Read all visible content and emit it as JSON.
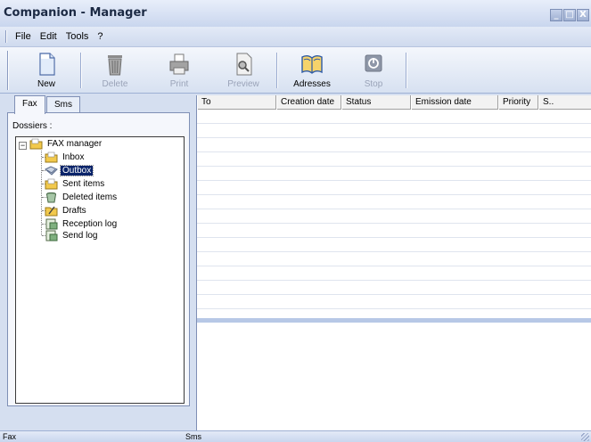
{
  "window": {
    "title": "Companion - Manager",
    "controls": {
      "minimize": "_",
      "maximize": "□",
      "close": "X"
    }
  },
  "menu": [
    {
      "label": "File"
    },
    {
      "label": "Edit"
    },
    {
      "label": "Tools"
    },
    {
      "label": "?"
    }
  ],
  "toolbar": {
    "buttons": [
      {
        "label": "New",
        "icon": "new-document-icon",
        "enabled": true
      },
      {
        "label": "Delete",
        "icon": "trash-icon",
        "enabled": false
      },
      {
        "label": "Print",
        "icon": "printer-icon",
        "enabled": false
      },
      {
        "label": "Preview",
        "icon": "preview-icon",
        "enabled": false
      },
      {
        "label": "Adresses",
        "icon": "address-book-icon",
        "enabled": true
      },
      {
        "label": "Stop",
        "icon": "stop-icon",
        "enabled": false
      }
    ]
  },
  "tabs": [
    {
      "label": "Fax",
      "active": true
    },
    {
      "label": "Sms",
      "active": false
    }
  ],
  "dossiers": {
    "label": "Dossiers :",
    "root": {
      "label": "FAX manager",
      "icon": "folder-icon",
      "expanded": true,
      "expander": "−"
    },
    "items": [
      {
        "label": "Inbox",
        "icon": "inbox-icon",
        "selected": false
      },
      {
        "label": "Outbox",
        "icon": "outbox-icon",
        "selected": true
      },
      {
        "label": "Sent items",
        "icon": "sent-items-icon",
        "selected": false
      },
      {
        "label": "Deleted items",
        "icon": "deleted-items-icon",
        "selected": false
      },
      {
        "label": "Drafts",
        "icon": "drafts-icon",
        "selected": false
      },
      {
        "label": "Reception log",
        "icon": "reception-log-icon",
        "selected": false
      },
      {
        "label": "Send log",
        "icon": "send-log-icon",
        "selected": false
      }
    ]
  },
  "grid": {
    "columns": [
      {
        "label": "To"
      },
      {
        "label": "Creation date"
      },
      {
        "label": "Status"
      },
      {
        "label": "Emission date"
      },
      {
        "label": "Priority"
      },
      {
        "label": "S.."
      }
    ],
    "rows": []
  },
  "statusbar": {
    "left": "Fax",
    "middle": "Sms"
  },
  "colors": {
    "accent": "#0a246a",
    "window_bg": "#d5dff0",
    "panel_border": "#7f8fb5"
  }
}
